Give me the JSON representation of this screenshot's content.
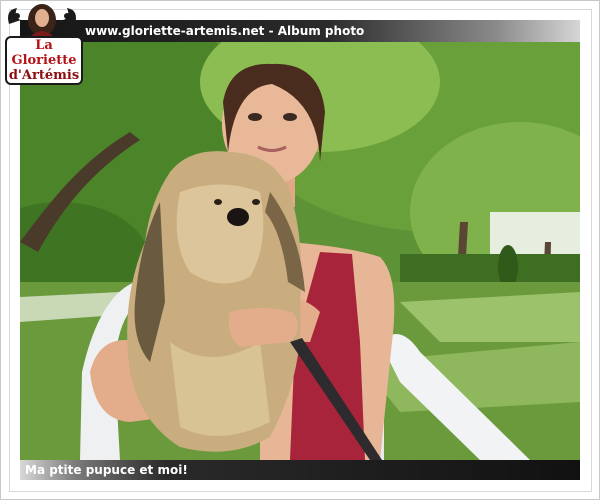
{
  "header": {
    "title": "www.gloriette-artemis.net - Album photo"
  },
  "logo": {
    "line1": "La Gloriette",
    "line2": "d'Artémis"
  },
  "photo": {
    "subject": "girl-holding-dog-in-garden"
  },
  "caption": {
    "text": "Ma ptite pupuce et moi!"
  },
  "colors": {
    "header_bar_dark": "#161616",
    "logo_red": "#b31217",
    "grass": "#6a9a3c",
    "foliage": "#4f8a2a"
  }
}
